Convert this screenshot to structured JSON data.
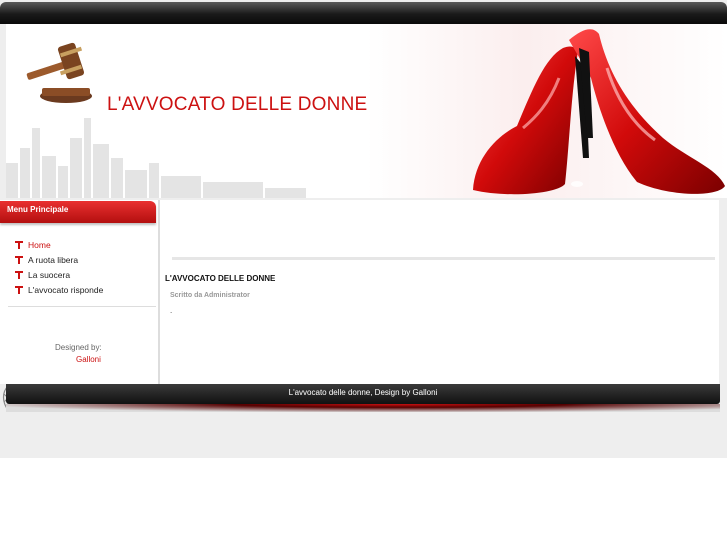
{
  "site": {
    "title": "L'AVVOCATO DELLE DONNE"
  },
  "sidebar": {
    "menu_title": "Menu Principale",
    "items": [
      {
        "label": "Home",
        "active": true
      },
      {
        "label": "A ruota libera",
        "active": false
      },
      {
        "label": "La suocera",
        "active": false
      },
      {
        "label": "L'avvocato risponde",
        "active": false
      }
    ],
    "designed_by_label": "Designed by:",
    "designer_name": "Galloni"
  },
  "article": {
    "title": "L'AVVOCATO DELLE DONNE",
    "author": "Scritto da Administrator",
    "body": "."
  },
  "footer": {
    "text": "L'avvocato delle donne, Design by Galloni"
  },
  "colors": {
    "accent": "#cc1111",
    "dark": "#111111",
    "background": "#eeeeee"
  },
  "icons": {
    "gavel": "gavel-icon",
    "shoes": "red-heels-icon",
    "bullet": "pin-bullet-icon"
  }
}
